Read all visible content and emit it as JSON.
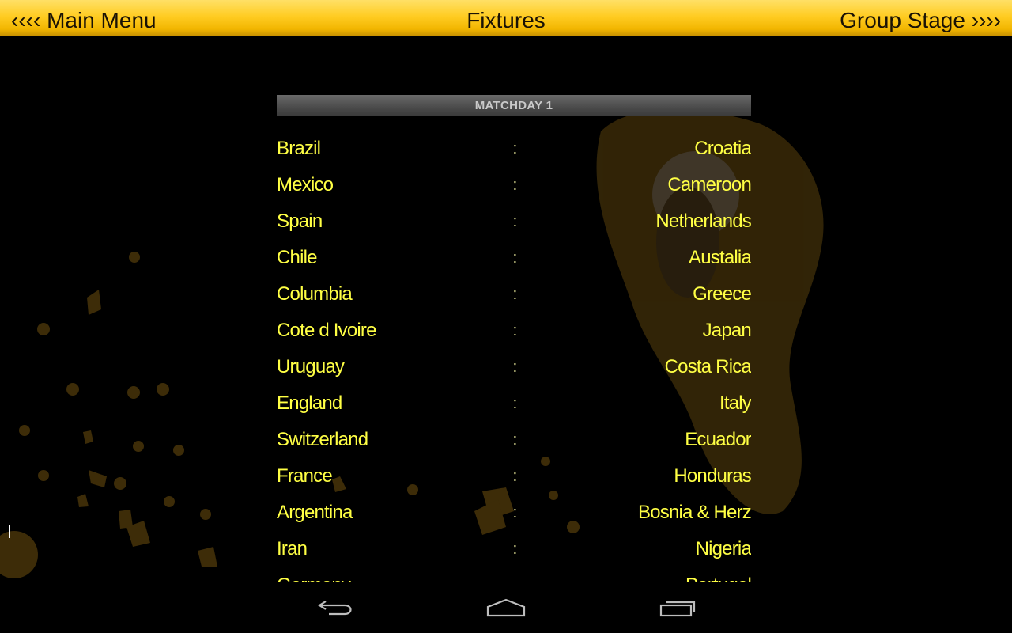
{
  "header": {
    "back_label": "‹‹‹‹ Main Menu",
    "title": "Fixtures",
    "next_label": "Group Stage ››››"
  },
  "section": {
    "title": "MATCHDAY 1"
  },
  "fixtures": [
    {
      "home": "Brazil",
      "sep": ":",
      "away": "Croatia"
    },
    {
      "home": "Mexico",
      "sep": ":",
      "away": "Cameroon"
    },
    {
      "home": "Spain",
      "sep": ":",
      "away": "Netherlands"
    },
    {
      "home": "Chile",
      "sep": ":",
      "away": "Austalia"
    },
    {
      "home": "Columbia",
      "sep": ":",
      "away": "Greece"
    },
    {
      "home": "Cote d Ivoire",
      "sep": ":",
      "away": "Japan"
    },
    {
      "home": "Uruguay",
      "sep": ":",
      "away": "Costa Rica"
    },
    {
      "home": "England",
      "sep": ":",
      "away": "Italy"
    },
    {
      "home": "Switzerland",
      "sep": ":",
      "away": "Ecuador"
    },
    {
      "home": "France",
      "sep": ":",
      "away": "Honduras"
    },
    {
      "home": "Argentina",
      "sep": ":",
      "away": "Bosnia & Herz"
    },
    {
      "home": "Iran",
      "sep": ":",
      "away": "Nigeria"
    },
    {
      "home": "Germany",
      "sep": ":",
      "away": "Portugal"
    }
  ],
  "system_nav": {
    "back_icon": "back-arrow-icon",
    "home_icon": "home-icon",
    "recents_icon": "recent-apps-icon"
  },
  "colors": {
    "accent": "#ffcc22",
    "team_text": "#ffff44",
    "header_bar": "#4a4a4a",
    "background": "#000000"
  }
}
